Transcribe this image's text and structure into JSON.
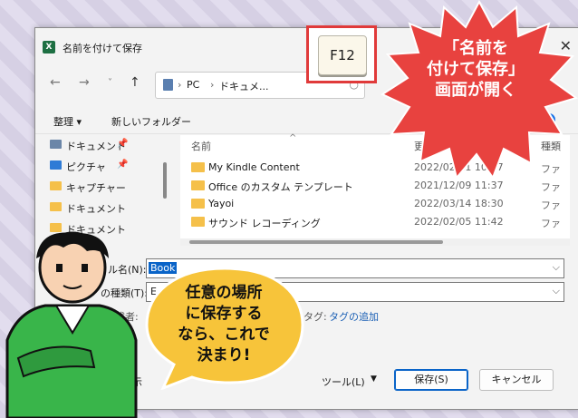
{
  "dialog": {
    "title": "名前を付けて保存",
    "app_icon": "X",
    "close": "✕",
    "address": [
      "PC",
      "ドキュメ..."
    ],
    "toolbar": {
      "organize": "整理 ▾",
      "new_folder": "新しいフォルダー",
      "help": "?"
    },
    "sidebar": [
      {
        "label": "ドキュメント",
        "icon": "doc",
        "pinned": true
      },
      {
        "label": "ピクチャ",
        "icon": "pic",
        "pinned": true
      },
      {
        "label": "キャプチャー",
        "icon": "folder",
        "pinned": false
      },
      {
        "label": "ドキュメント",
        "icon": "folder",
        "pinned": false
      },
      {
        "label": "ドキュメント",
        "icon": "folder",
        "pinned": false
      }
    ],
    "columns": {
      "name": "名前",
      "modified": "更新",
      "type": "種類"
    },
    "files": [
      {
        "name": "My Kindle Content",
        "modified": "2022/02/11 10:07",
        "type": "ファ"
      },
      {
        "name": "Office のカスタム テンプレート",
        "modified": "2021/12/09 11:37",
        "type": "ファ"
      },
      {
        "name": "Yayoi",
        "modified": "2022/03/14 18:30",
        "type": "ファ"
      },
      {
        "name": "サウンド レコーディング",
        "modified": "2022/02/05 11:42",
        "type": "ファ"
      }
    ],
    "filename_label": "ル名(N):",
    "filename_value": "Book",
    "filetype_label": "の種類(T):",
    "filetype_value": "E",
    "author_label": "成者:",
    "tags_label": "タグ:",
    "tags_value": "タグの追加",
    "hide_folders": "表示",
    "tools": "ツール(L)",
    "save": "保存(S)",
    "cancel": "キャンセル"
  },
  "callouts": {
    "key": "F12",
    "burst_lines": [
      "「名前を",
      "付けて保存」",
      "画面が開く"
    ],
    "bubble_lines": [
      "任意の場所",
      "に保存する",
      "なら、これで",
      "決まり!"
    ]
  },
  "colors": {
    "burst": "#e8423f",
    "bubble": "#f7c43a",
    "shirt": "#39b54a",
    "key_border": "#e03a3a"
  }
}
